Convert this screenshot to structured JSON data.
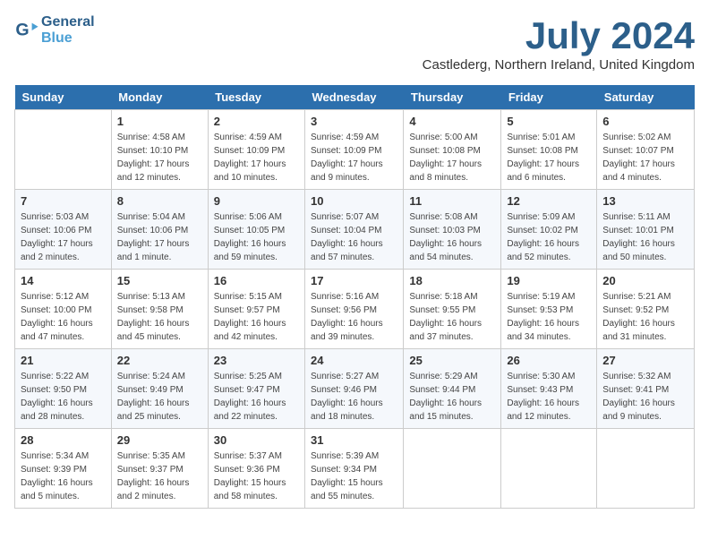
{
  "header": {
    "logo_line1": "General",
    "logo_line2": "Blue",
    "month_title": "July 2024",
    "subtitle": "Castlederg, Northern Ireland, United Kingdom"
  },
  "weekdays": [
    "Sunday",
    "Monday",
    "Tuesday",
    "Wednesday",
    "Thursday",
    "Friday",
    "Saturday"
  ],
  "weeks": [
    [
      {
        "day": "",
        "sunrise": "",
        "sunset": "",
        "daylight": ""
      },
      {
        "day": "1",
        "sunrise": "Sunrise: 4:58 AM",
        "sunset": "Sunset: 10:10 PM",
        "daylight": "Daylight: 17 hours and 12 minutes."
      },
      {
        "day": "2",
        "sunrise": "Sunrise: 4:59 AM",
        "sunset": "Sunset: 10:09 PM",
        "daylight": "Daylight: 17 hours and 10 minutes."
      },
      {
        "day": "3",
        "sunrise": "Sunrise: 4:59 AM",
        "sunset": "Sunset: 10:09 PM",
        "daylight": "Daylight: 17 hours and 9 minutes."
      },
      {
        "day": "4",
        "sunrise": "Sunrise: 5:00 AM",
        "sunset": "Sunset: 10:08 PM",
        "daylight": "Daylight: 17 hours and 8 minutes."
      },
      {
        "day": "5",
        "sunrise": "Sunrise: 5:01 AM",
        "sunset": "Sunset: 10:08 PM",
        "daylight": "Daylight: 17 hours and 6 minutes."
      },
      {
        "day": "6",
        "sunrise": "Sunrise: 5:02 AM",
        "sunset": "Sunset: 10:07 PM",
        "daylight": "Daylight: 17 hours and 4 minutes."
      }
    ],
    [
      {
        "day": "7",
        "sunrise": "Sunrise: 5:03 AM",
        "sunset": "Sunset: 10:06 PM",
        "daylight": "Daylight: 17 hours and 2 minutes."
      },
      {
        "day": "8",
        "sunrise": "Sunrise: 5:04 AM",
        "sunset": "Sunset: 10:06 PM",
        "daylight": "Daylight: 17 hours and 1 minute."
      },
      {
        "day": "9",
        "sunrise": "Sunrise: 5:06 AM",
        "sunset": "Sunset: 10:05 PM",
        "daylight": "Daylight: 16 hours and 59 minutes."
      },
      {
        "day": "10",
        "sunrise": "Sunrise: 5:07 AM",
        "sunset": "Sunset: 10:04 PM",
        "daylight": "Daylight: 16 hours and 57 minutes."
      },
      {
        "day": "11",
        "sunrise": "Sunrise: 5:08 AM",
        "sunset": "Sunset: 10:03 PM",
        "daylight": "Daylight: 16 hours and 54 minutes."
      },
      {
        "day": "12",
        "sunrise": "Sunrise: 5:09 AM",
        "sunset": "Sunset: 10:02 PM",
        "daylight": "Daylight: 16 hours and 52 minutes."
      },
      {
        "day": "13",
        "sunrise": "Sunrise: 5:11 AM",
        "sunset": "Sunset: 10:01 PM",
        "daylight": "Daylight: 16 hours and 50 minutes."
      }
    ],
    [
      {
        "day": "14",
        "sunrise": "Sunrise: 5:12 AM",
        "sunset": "Sunset: 10:00 PM",
        "daylight": "Daylight: 16 hours and 47 minutes."
      },
      {
        "day": "15",
        "sunrise": "Sunrise: 5:13 AM",
        "sunset": "Sunset: 9:58 PM",
        "daylight": "Daylight: 16 hours and 45 minutes."
      },
      {
        "day": "16",
        "sunrise": "Sunrise: 5:15 AM",
        "sunset": "Sunset: 9:57 PM",
        "daylight": "Daylight: 16 hours and 42 minutes."
      },
      {
        "day": "17",
        "sunrise": "Sunrise: 5:16 AM",
        "sunset": "Sunset: 9:56 PM",
        "daylight": "Daylight: 16 hours and 39 minutes."
      },
      {
        "day": "18",
        "sunrise": "Sunrise: 5:18 AM",
        "sunset": "Sunset: 9:55 PM",
        "daylight": "Daylight: 16 hours and 37 minutes."
      },
      {
        "day": "19",
        "sunrise": "Sunrise: 5:19 AM",
        "sunset": "Sunset: 9:53 PM",
        "daylight": "Daylight: 16 hours and 34 minutes."
      },
      {
        "day": "20",
        "sunrise": "Sunrise: 5:21 AM",
        "sunset": "Sunset: 9:52 PM",
        "daylight": "Daylight: 16 hours and 31 minutes."
      }
    ],
    [
      {
        "day": "21",
        "sunrise": "Sunrise: 5:22 AM",
        "sunset": "Sunset: 9:50 PM",
        "daylight": "Daylight: 16 hours and 28 minutes."
      },
      {
        "day": "22",
        "sunrise": "Sunrise: 5:24 AM",
        "sunset": "Sunset: 9:49 PM",
        "daylight": "Daylight: 16 hours and 25 minutes."
      },
      {
        "day": "23",
        "sunrise": "Sunrise: 5:25 AM",
        "sunset": "Sunset: 9:47 PM",
        "daylight": "Daylight: 16 hours and 22 minutes."
      },
      {
        "day": "24",
        "sunrise": "Sunrise: 5:27 AM",
        "sunset": "Sunset: 9:46 PM",
        "daylight": "Daylight: 16 hours and 18 minutes."
      },
      {
        "day": "25",
        "sunrise": "Sunrise: 5:29 AM",
        "sunset": "Sunset: 9:44 PM",
        "daylight": "Daylight: 16 hours and 15 minutes."
      },
      {
        "day": "26",
        "sunrise": "Sunrise: 5:30 AM",
        "sunset": "Sunset: 9:43 PM",
        "daylight": "Daylight: 16 hours and 12 minutes."
      },
      {
        "day": "27",
        "sunrise": "Sunrise: 5:32 AM",
        "sunset": "Sunset: 9:41 PM",
        "daylight": "Daylight: 16 hours and 9 minutes."
      }
    ],
    [
      {
        "day": "28",
        "sunrise": "Sunrise: 5:34 AM",
        "sunset": "Sunset: 9:39 PM",
        "daylight": "Daylight: 16 hours and 5 minutes."
      },
      {
        "day": "29",
        "sunrise": "Sunrise: 5:35 AM",
        "sunset": "Sunset: 9:37 PM",
        "daylight": "Daylight: 16 hours and 2 minutes."
      },
      {
        "day": "30",
        "sunrise": "Sunrise: 5:37 AM",
        "sunset": "Sunset: 9:36 PM",
        "daylight": "Daylight: 15 hours and 58 minutes."
      },
      {
        "day": "31",
        "sunrise": "Sunrise: 5:39 AM",
        "sunset": "Sunset: 9:34 PM",
        "daylight": "Daylight: 15 hours and 55 minutes."
      },
      {
        "day": "",
        "sunrise": "",
        "sunset": "",
        "daylight": ""
      },
      {
        "day": "",
        "sunrise": "",
        "sunset": "",
        "daylight": ""
      },
      {
        "day": "",
        "sunrise": "",
        "sunset": "",
        "daylight": ""
      }
    ]
  ]
}
